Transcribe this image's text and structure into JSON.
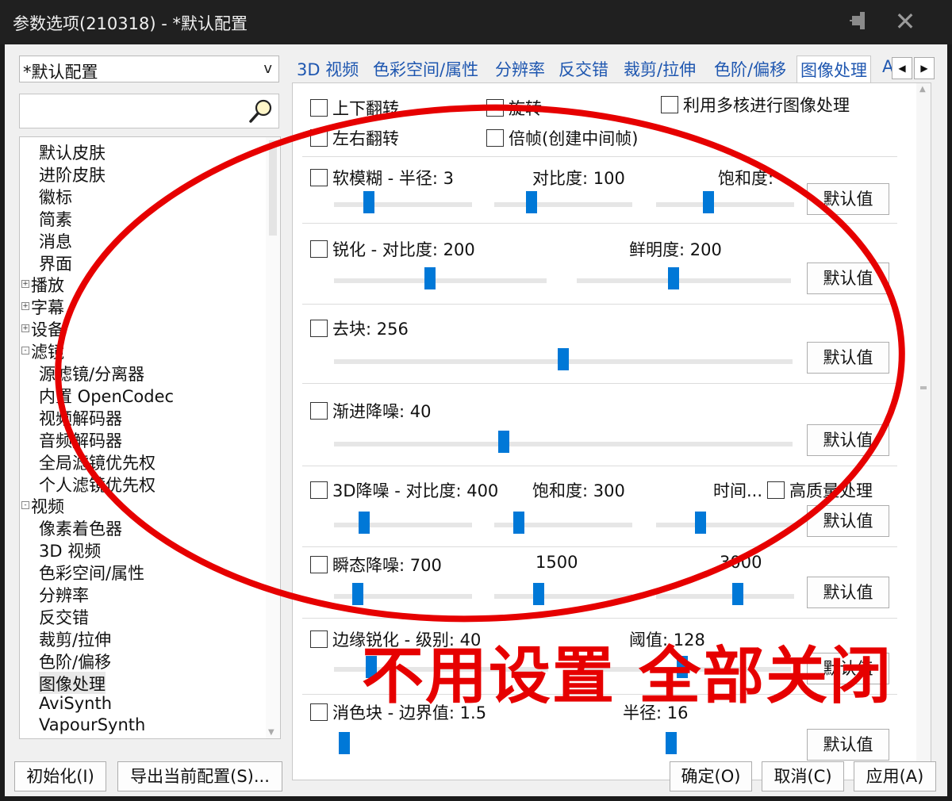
{
  "window": {
    "title": "参数选项(210318) - *默认配置",
    "pin_icon": "pin-icon",
    "close_label": "✕"
  },
  "left": {
    "profile": "*默认配置",
    "profile_arrow": "v",
    "tree": [
      {
        "label": "默认皮肤"
      },
      {
        "label": "进阶皮肤"
      },
      {
        "label": "徽标"
      },
      {
        "label": "简素"
      },
      {
        "label": "消息"
      },
      {
        "label": "界面"
      },
      {
        "label": "播放",
        "expander": "+"
      },
      {
        "label": "字幕",
        "expander": "+"
      },
      {
        "label": "设备",
        "expander": "+"
      },
      {
        "label": "滤镜",
        "expander": "-"
      },
      {
        "label": "源滤镜/分离器"
      },
      {
        "label": "内置 OpenCodec"
      },
      {
        "label": "视频解码器"
      },
      {
        "label": "音频解码器"
      },
      {
        "label": "全局滤镜优先权"
      },
      {
        "label": "个人滤镜优先权"
      },
      {
        "label": "视频",
        "expander": "-"
      },
      {
        "label": "像素着色器"
      },
      {
        "label": "3D 视频"
      },
      {
        "label": "色彩空间/属性"
      },
      {
        "label": "分辨率"
      },
      {
        "label": "反交错"
      },
      {
        "label": "裁剪/拉伸"
      },
      {
        "label": "色阶/偏移"
      },
      {
        "label": "图像处理",
        "selected": true
      },
      {
        "label": "AviSynth"
      },
      {
        "label": "VapourSynth"
      }
    ]
  },
  "tabs": {
    "items": [
      "3D 视频",
      "色彩空间/属性",
      "分辨率",
      "反交错",
      "裁剪/拉伸",
      "色阶/偏移",
      "图像处理",
      "A"
    ],
    "active": "图像处理",
    "prev": "◀",
    "next": "▶"
  },
  "image_processing": {
    "flip_vertical": "上下翻转",
    "rotate": "旋转",
    "multicore": "利用多核进行图像处理",
    "flip_horizontal": "左右翻转",
    "frame_double": "倍帧(创建中间帧)",
    "soft_blur": {
      "label": "软模糊 - 半径: 3",
      "contrast": "对比度: 100",
      "saturation": "饱和度:",
      "levels": [
        0.25,
        0.27,
        0.38
      ]
    },
    "sharpen": {
      "label": "锐化 - 对比度: 200",
      "clarity": "鲜明度: 200",
      "levels": [
        0.45,
        0.45
      ]
    },
    "deblock": {
      "label": "去块: 256",
      "level": 0.5
    },
    "temporal_denoise": {
      "label": "渐进降噪: 40",
      "level": 0.37
    },
    "denoise3d": {
      "label": "3D降噪 - 对比度: 400",
      "saturation": "饱和度: 300",
      "time": "时间...",
      "hq": "高质量处理",
      "levels": [
        0.22,
        0.18,
        0.32
      ]
    },
    "transient_denoise": {
      "label": "瞬态降噪: 700",
      "v2": "1500",
      "v3": "3000",
      "levels": [
        0.17,
        0.32,
        0.59
      ]
    },
    "edge_sharpen": {
      "label": "边缘锐化 - 级别: 40",
      "threshold": "阈值: 128"
    },
    "deband": {
      "label": "消色块 - 边界值: 1.5",
      "radius": "半径: 16"
    },
    "default_button": "默认值"
  },
  "buttons": {
    "init": "初始化(I)",
    "export": "导出当前配置(S)...",
    "ok": "确定(O)",
    "cancel": "取消(C)",
    "apply": "应用(A)"
  },
  "annotation": {
    "text": "不用设置 全部关闭",
    "color": "#e60000"
  }
}
